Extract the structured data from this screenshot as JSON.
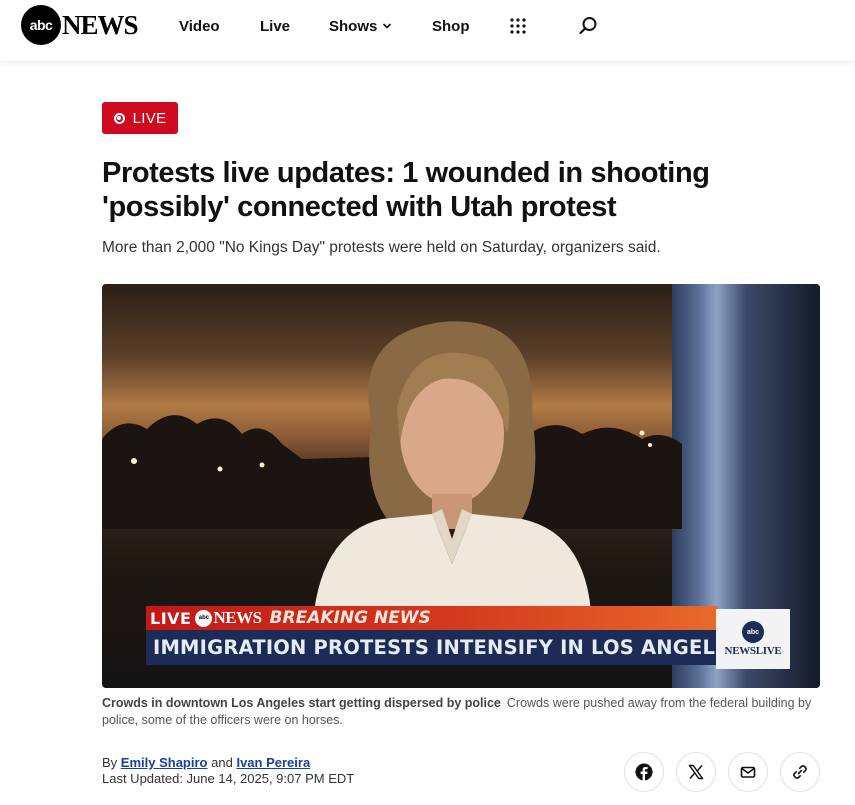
{
  "header": {
    "logo_mark": "abc",
    "logo_text": "NEWS",
    "nav": [
      {
        "label": "Video"
      },
      {
        "label": "Live"
      },
      {
        "label": "Shows"
      },
      {
        "label": "Shop"
      }
    ],
    "icons": {
      "grid": "grid-icon",
      "search": "search-icon",
      "chevron": "chevron-down-icon"
    }
  },
  "article": {
    "live_label": "LIVE",
    "headline": "Protests live updates: 1 wounded in shooting 'possibly' connected with Utah protest",
    "subhead": "More than 2,000 \"No Kings Day\" protests were held on Saturday, organizers said.",
    "video": {
      "ticker_live": "LIVE",
      "ticker_logo_mark": "abc",
      "ticker_logo_text": "NEWS",
      "ticker_breaking": "BREAKING NEWS",
      "ticker_headline": "IMMIGRATION PROTESTS INTENSIFY IN LOS ANGELES",
      "newslive_mark": "abc",
      "newslive_text": "NEWSLIVE"
    },
    "caption_title": "Crowds in downtown Los Angeles start getting dispersed by police",
    "caption_text": "Crowds were pushed away from the federal building by police, some of the officers were on horses.",
    "byline_prefix": "By",
    "author1": "Emily Shapiro",
    "byline_and": "and",
    "author2": "Ivan Pereira",
    "updated": "Last Updated: June 14, 2025, 9:07 PM EDT"
  },
  "share": [
    "facebook-icon",
    "x-icon",
    "mail-icon",
    "link-icon"
  ],
  "colors": {
    "live_red": "#d00a1e",
    "link_blue": "#1a3e9c",
    "ticker_navy": "#1d2c56"
  }
}
